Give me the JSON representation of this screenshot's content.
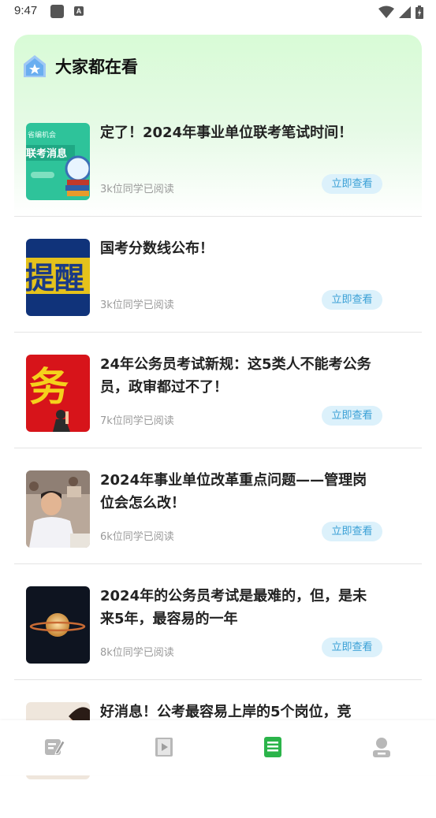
{
  "status_bar": {
    "time": "9:47",
    "a_icon": "A"
  },
  "section": {
    "title": "大家都在看",
    "icon": "house-star-icon"
  },
  "articles": [
    {
      "title": "定了！2024年事业单位联考笔试时间！",
      "reads": "3k位同学已阅读",
      "button": "立即查看",
      "thumb_texts": [
        "联考消息",
        "省编机会"
      ]
    },
    {
      "title": "国考分数线公布！",
      "reads": "3k位同学已阅读",
      "button": "立即查看",
      "thumb_texts": [
        "提醒"
      ]
    },
    {
      "title": "24年公务员考试新规：这5类人不能考公务员，政审都过不了！",
      "reads": "7k位同学已阅读",
      "button": "立即查看",
      "thumb_texts": [
        "务"
      ]
    },
    {
      "title": "2024年事业单位改革重点问题——管理岗位会怎么改！",
      "reads": "6k位同学已阅读",
      "button": "立即查看",
      "thumb_texts": []
    },
    {
      "title": "2024年的公务员考试是最难的，但，是未来5年，最容易的一年",
      "reads": "8k位同学已阅读",
      "button": "立即查看",
      "thumb_texts": []
    },
    {
      "title": "好消息！公考最容易上岸的5个岗位，竞",
      "reads": "",
      "button": "",
      "thumb_texts": []
    }
  ],
  "bottom_nav": [
    {
      "icon": "edit-note-icon",
      "active": false
    },
    {
      "icon": "video-play-icon",
      "active": false
    },
    {
      "icon": "document-list-icon",
      "active": true
    },
    {
      "icon": "user-profile-icon",
      "active": false
    }
  ],
  "colors": {
    "accent": "#2bb44a",
    "button_bg": "#dcf1fb",
    "button_text": "#3aa0d6",
    "inactive_icon": "#b8b8b8"
  }
}
